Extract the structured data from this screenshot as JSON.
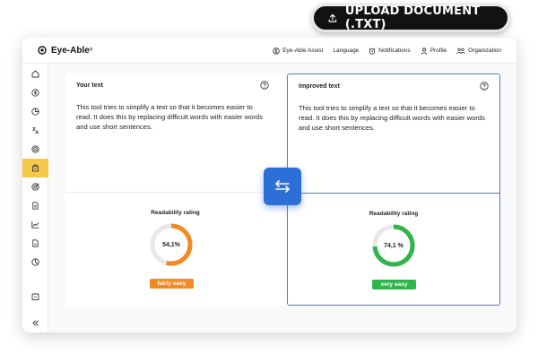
{
  "upload_button": {
    "label": "UPLOAD DOCUMENT (.TXT)",
    "icon": "upload-icon"
  },
  "app": {
    "brand": "Eye-Able",
    "brand_mark": "®"
  },
  "nav": [
    {
      "label": "Eye-Able Assist",
      "icon": "dollar-circle-icon"
    },
    {
      "label": "Language",
      "icon": ""
    },
    {
      "label": "Notifications",
      "icon": "alarm-icon"
    },
    {
      "label": "Profile",
      "icon": "person-icon"
    },
    {
      "label": "Organization",
      "icon": "people-icon"
    }
  ],
  "sidebar": [
    {
      "icon": "home-icon",
      "active": false
    },
    {
      "icon": "dollar-icon",
      "active": false
    },
    {
      "icon": "pie-chart-icon",
      "active": false
    },
    {
      "icon": "translate-icon",
      "active": false
    },
    {
      "icon": "target-icon",
      "active": false
    },
    {
      "icon": "document-tool-icon",
      "active": true
    },
    {
      "icon": "goal-icon",
      "active": false
    },
    {
      "icon": "pdf-icon",
      "active": false
    },
    {
      "icon": "line-chart-icon",
      "active": false
    },
    {
      "icon": "report-icon",
      "active": false
    },
    {
      "icon": "clock-chart-icon",
      "active": false
    },
    {
      "icon": "message-icon",
      "active": false
    },
    {
      "icon": "collapse-icon",
      "active": false
    }
  ],
  "your_text": {
    "title": "Your text",
    "body": "This tool tries to simplify a text so that it becomes easier to read. It does this by replacing difficult words with easier words and use short sentences.",
    "rating_label": "Readability rating",
    "score": "54,1%",
    "score_value": 54.1,
    "badge": "fairly easy",
    "color": "#f28a24"
  },
  "improved_text": {
    "title": "Improved text",
    "body": "This tool tries to simplify a text so that it becomes easier to read. It does this by replacing difficult words with easier words and use short sentences.",
    "rating_label": "Readability rating",
    "score": "74,1 %",
    "score_value": 74.1,
    "badge": "very easy",
    "color": "#2fb54a"
  },
  "accent": "#2c6fd6"
}
